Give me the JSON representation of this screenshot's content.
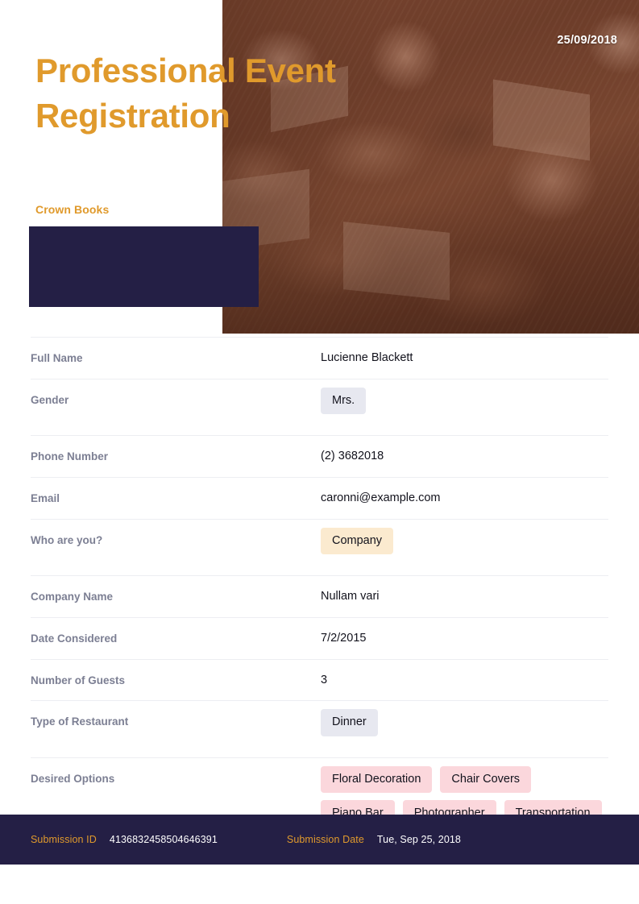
{
  "hero": {
    "title": "Professional Event Registration",
    "date": "25/09/2018",
    "organization": "Crown Books",
    "photo_alt": "conference-attendees-with-laptops"
  },
  "colors": {
    "accent_orange": "#e09a2c",
    "dark_navy": "#241f45",
    "label_gray": "#7c7f93",
    "chip_neutral": "#e7e8f0",
    "chip_warm": "#fbeacf",
    "chip_pink": "#fbd7dc",
    "divider": "#edeef2"
  },
  "fields": [
    {
      "label": "Full Name",
      "value": "Lucienne Blackett",
      "type": "text"
    },
    {
      "label": "Gender",
      "chips": [
        "Mrs."
      ],
      "type": "chip",
      "chip_style": "neutral"
    },
    {
      "label": "Phone Number",
      "value": "(2) 3682018",
      "type": "text"
    },
    {
      "label": "Email",
      "value": "caronni@example.com",
      "type": "text"
    },
    {
      "label": "Who are you?",
      "chips": [
        "Company"
      ],
      "type": "chip",
      "chip_style": "warm"
    },
    {
      "label": "Company Name",
      "value": "Nullam vari",
      "type": "text"
    },
    {
      "label": "Date Considered",
      "value": "7/2/2015",
      "type": "text"
    },
    {
      "label": "Number of Guests",
      "value": "3",
      "type": "text"
    },
    {
      "label": "Type of Restaurant",
      "chips": [
        "Dinner"
      ],
      "type": "chip",
      "chip_style": "neutral"
    },
    {
      "label": "Desired Options",
      "chips": [
        "Floral Decoration",
        "Chair Covers",
        "Piano Bar",
        "Photographer",
        "Transportation"
      ],
      "type": "chip",
      "chip_style": "pink"
    }
  ],
  "footer": {
    "submission_id_label": "Submission ID",
    "submission_id_value": "4136832458504646391",
    "submission_date_label": "Submission Date",
    "submission_date_value": "Tue, Sep 25, 2018"
  }
}
